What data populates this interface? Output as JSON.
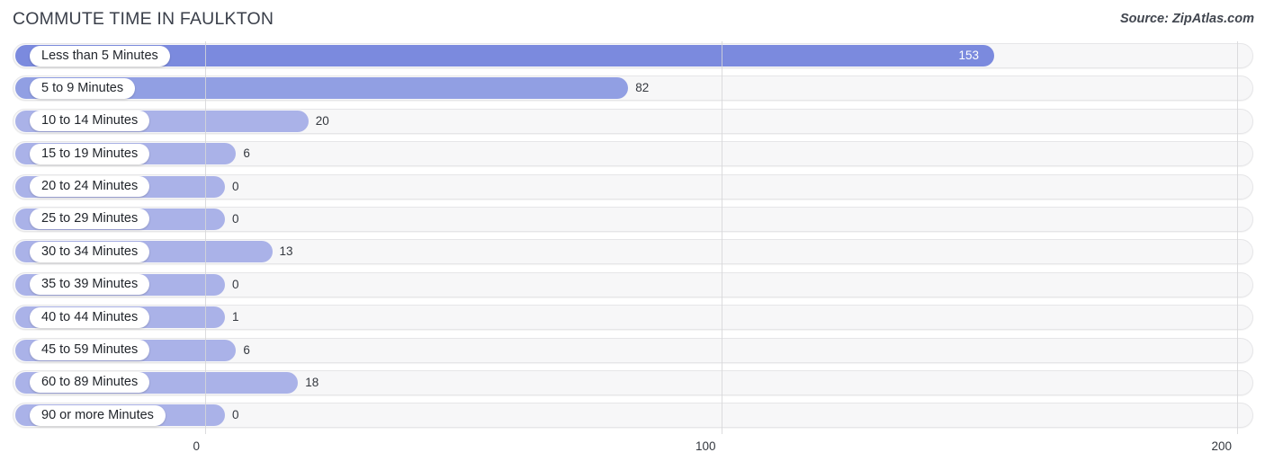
{
  "header": {
    "title": "COMMUTE TIME IN FAULKTON",
    "source": "Source: ZipAtlas.com"
  },
  "colors": {
    "bar_primary": "#7b8ade",
    "bar_secondary": "#919fe3",
    "bar_default": "#aab2e8",
    "track": "#f7f7f8",
    "gridline": "#d6d6d8",
    "text": "#34383f",
    "value_inside": "#ffffff"
  },
  "chart_data": {
    "type": "bar",
    "orientation": "horizontal",
    "title": "COMMUTE TIME IN FAULKTON",
    "xlabel": "",
    "ylabel": "",
    "xlim": [
      0,
      200
    ],
    "ticks": [
      0,
      100,
      200
    ],
    "tick_labels": [
      "0",
      "100",
      "200"
    ],
    "grid": true,
    "legend": false,
    "categories": [
      "Less than 5 Minutes",
      "5 to 9 Minutes",
      "10 to 14 Minutes",
      "15 to 19 Minutes",
      "20 to 24 Minutes",
      "25 to 29 Minutes",
      "30 to 34 Minutes",
      "35 to 39 Minutes",
      "40 to 44 Minutes",
      "45 to 59 Minutes",
      "60 to 89 Minutes",
      "90 or more Minutes"
    ],
    "values": [
      153,
      82,
      20,
      6,
      0,
      0,
      13,
      0,
      1,
      6,
      18,
      0
    ],
    "value_labels": [
      "153",
      "82",
      "20",
      "6",
      "0",
      "0",
      "13",
      "0",
      "1",
      "6",
      "18",
      "0"
    ]
  },
  "rows": [
    {
      "label": "Less than 5 Minutes",
      "value": 153,
      "value_label": "153",
      "style": "dark",
      "inside": true
    },
    {
      "label": "5 to 9 Minutes",
      "value": 82,
      "value_label": "82",
      "style": "mid",
      "inside": false
    },
    {
      "label": "10 to 14 Minutes",
      "value": 20,
      "value_label": "20",
      "style": "light",
      "inside": false
    },
    {
      "label": "15 to 19 Minutes",
      "value": 6,
      "value_label": "6",
      "style": "light",
      "inside": false
    },
    {
      "label": "20 to 24 Minutes",
      "value": 0,
      "value_label": "0",
      "style": "light",
      "inside": false
    },
    {
      "label": "25 to 29 Minutes",
      "value": 0,
      "value_label": "0",
      "style": "light",
      "inside": false
    },
    {
      "label": "30 to 34 Minutes",
      "value": 13,
      "value_label": "13",
      "style": "light",
      "inside": false
    },
    {
      "label": "35 to 39 Minutes",
      "value": 0,
      "value_label": "0",
      "style": "light",
      "inside": false
    },
    {
      "label": "40 to 44 Minutes",
      "value": 1,
      "value_label": "1",
      "style": "light",
      "inside": false
    },
    {
      "label": "45 to 59 Minutes",
      "value": 6,
      "value_label": "6",
      "style": "light",
      "inside": false
    },
    {
      "label": "60 to 89 Minutes",
      "value": 18,
      "value_label": "18",
      "style": "light",
      "inside": false
    },
    {
      "label": "90 or more Minutes",
      "value": 0,
      "value_label": "0",
      "style": "light",
      "inside": false
    }
  ],
  "axis": {
    "ticks": [
      {
        "label": "0",
        "value": 0
      },
      {
        "label": "100",
        "value": 100
      },
      {
        "label": "200",
        "value": 200
      }
    ]
  }
}
